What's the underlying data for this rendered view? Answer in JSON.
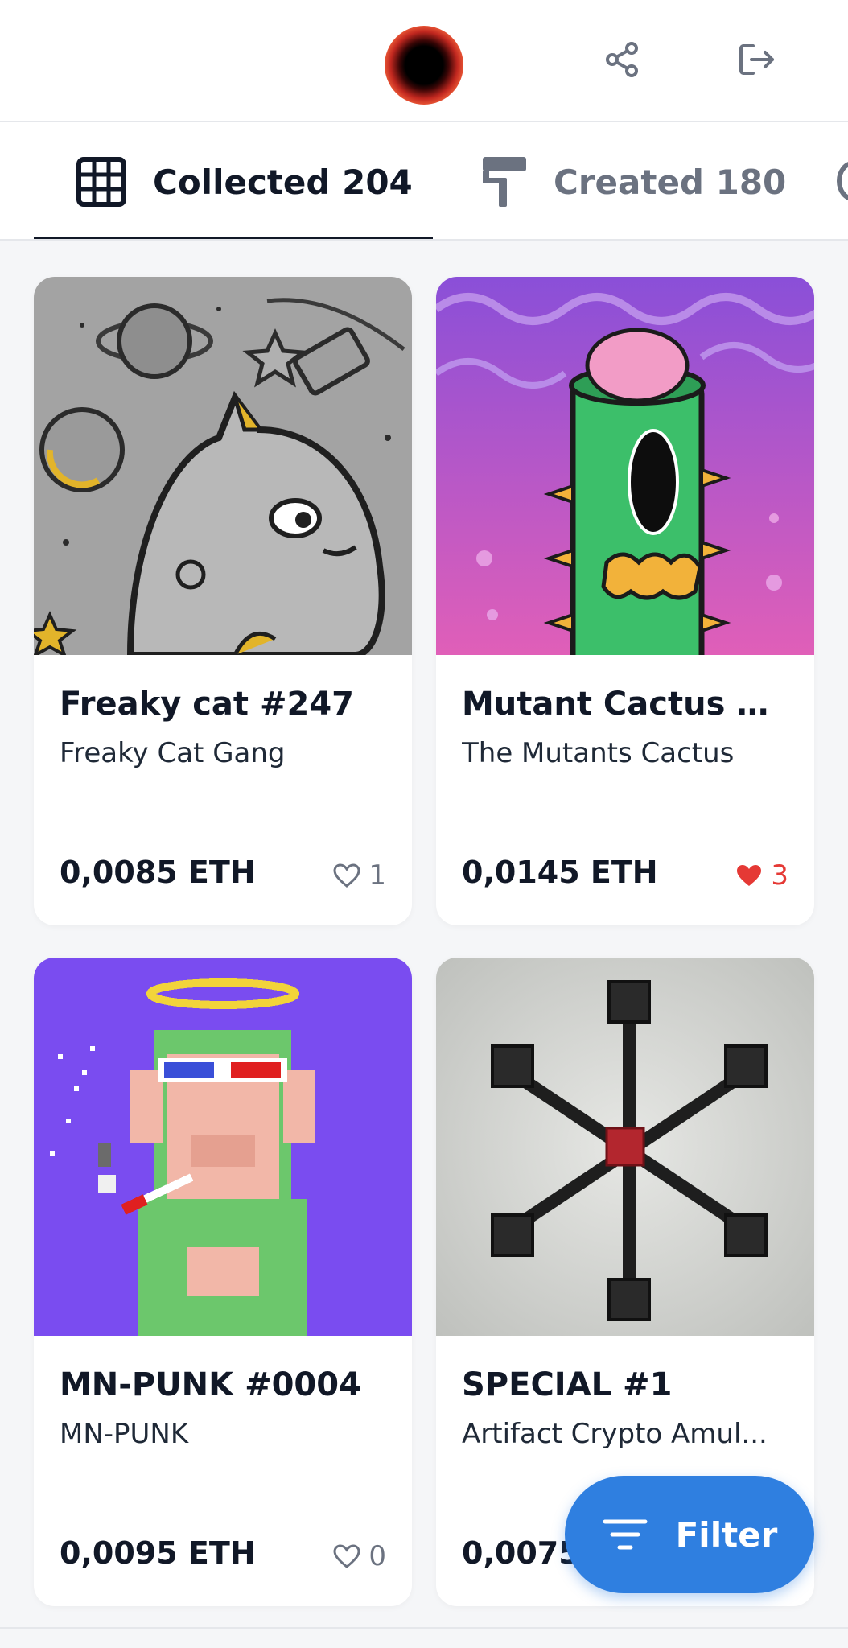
{
  "header": {
    "avatar_icon": "profile-avatar",
    "share_icon": "share-icon",
    "logout_icon": "logout-icon"
  },
  "tabs": [
    {
      "label": "Collected 204",
      "icon": "grid-icon",
      "active": true
    },
    {
      "label": "Created 180",
      "icon": "paint-roller-icon",
      "active": false
    }
  ],
  "cards": [
    {
      "title": "Freaky cat #247",
      "collection": "Freaky Cat Gang",
      "price": "0,0085 ETH",
      "likes": "1",
      "liked": false
    },
    {
      "title": "Mutant Cactus #...",
      "collection": "The Mutants Cactus",
      "price": "0,0145 ETH",
      "likes": "3",
      "liked": true
    },
    {
      "title": "MN-PUNK #0004",
      "collection": "MN-PUNK",
      "price": "0,0095 ETH",
      "likes": "0",
      "liked": false
    },
    {
      "title": "SPECIAL #1",
      "collection": "Artifact Crypto Amul...",
      "price": "0,0075 ETH",
      "likes": "",
      "liked": false
    }
  ],
  "filter_button": {
    "label": "Filter",
    "icon": "filter-icon"
  },
  "colors": {
    "accent": "#2f7fe0",
    "like_red": "#e53935",
    "text": "#111827",
    "muted": "#6b7280"
  }
}
